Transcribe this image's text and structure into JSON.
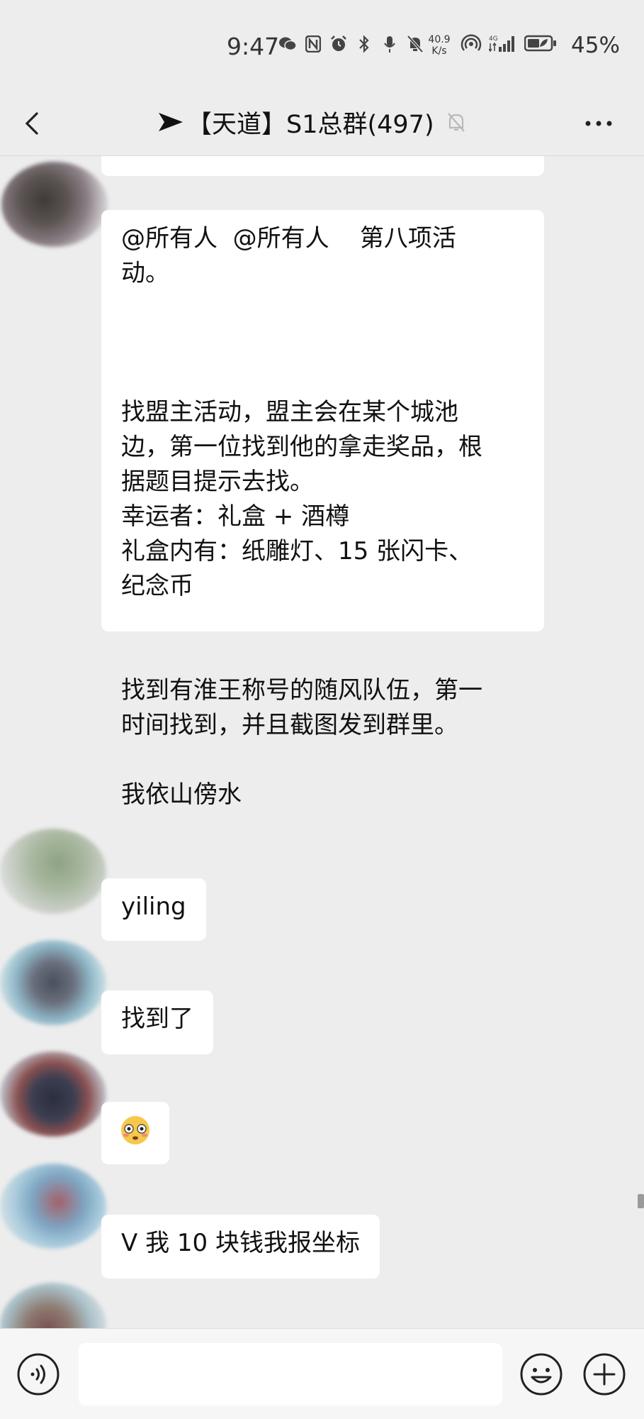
{
  "status_bar": {
    "time": "9:47",
    "network_speed_value": "40.9",
    "network_speed_unit": "K/s",
    "network_type": "4G",
    "battery_percent": "45%"
  },
  "header": {
    "title": "【天道】S1总群(497)",
    "title_prefix_icon": "send-arrow-icon",
    "muted": true
  },
  "messages": [
    {
      "type": "text",
      "lines": [
        "@所有人  @所有人    第八项活",
        "动。",
        "",
        "",
        "",
        "找盟主活动，盟主会在某个城池",
        "边，第一位找到他的拿走奖品，根",
        "据题目提示去找。",
        "幸运者：礼盒 + 酒樽",
        "礼盒内有：纸雕灯、15 张闪卡、",
        "纪念币",
        "",
        "",
        "找到有淮王称号的随风队伍，第一",
        "时间找到，并且截图发到群里。",
        "",
        "我依山傍水"
      ]
    },
    {
      "type": "text",
      "text": "yiling"
    },
    {
      "type": "text",
      "text": "找到了"
    },
    {
      "type": "emoji",
      "text": "😳"
    },
    {
      "type": "text",
      "text": "V 我 10 块钱我报坐标"
    }
  ],
  "input": {
    "placeholder": ""
  },
  "colors": {
    "background": "#ededed",
    "bubble": "#ffffff",
    "bottom_bar": "#f6f6f6"
  }
}
